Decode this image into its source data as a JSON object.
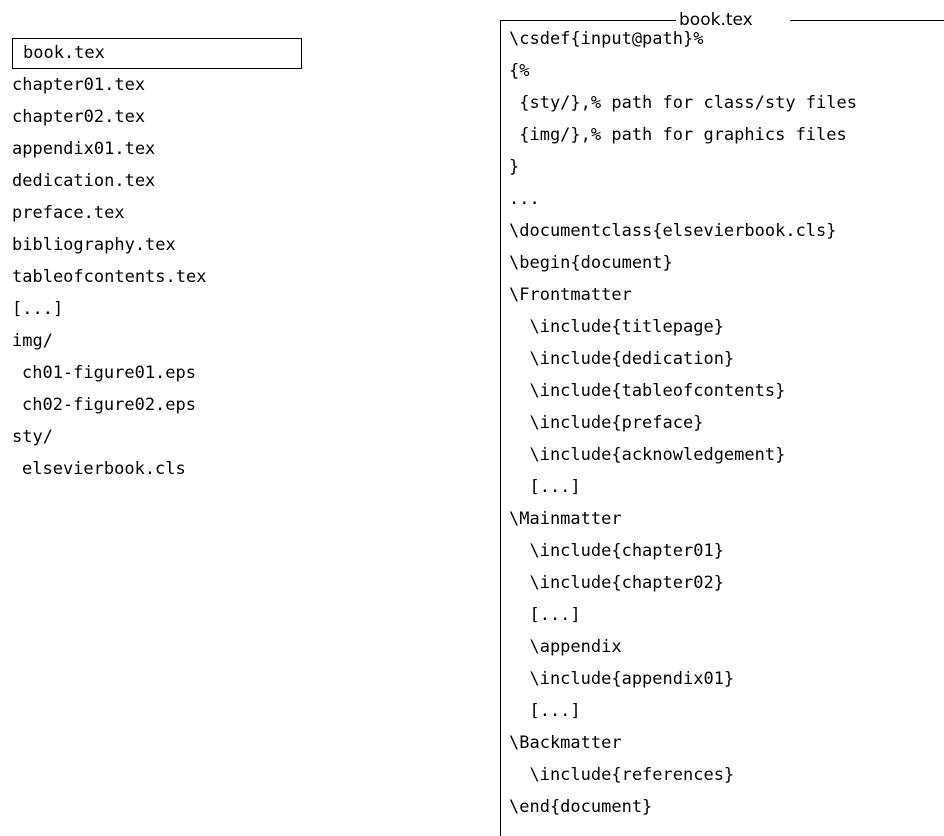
{
  "file_tree": {
    "items": [
      {
        "label": "book.tex",
        "selected": true,
        "indent": false
      },
      {
        "label": "chapter01.tex",
        "selected": false,
        "indent": false
      },
      {
        "label": "chapter02.tex",
        "selected": false,
        "indent": false
      },
      {
        "label": "appendix01.tex",
        "selected": false,
        "indent": false
      },
      {
        "label": "dedication.tex",
        "selected": false,
        "indent": false
      },
      {
        "label": "preface.tex",
        "selected": false,
        "indent": false
      },
      {
        "label": "bibliography.tex",
        "selected": false,
        "indent": false
      },
      {
        "label": "tableofcontents.tex",
        "selected": false,
        "indent": false
      },
      {
        "label": "[...]",
        "selected": false,
        "indent": false
      },
      {
        "label": "img/",
        "selected": false,
        "indent": false
      },
      {
        "label": "ch01-figure01.eps",
        "selected": false,
        "indent": true
      },
      {
        "label": "ch02-figure02.eps",
        "selected": false,
        "indent": true
      },
      {
        "label": "sty/",
        "selected": false,
        "indent": false
      },
      {
        "label": "elsevierbook.cls",
        "selected": false,
        "indent": true
      }
    ]
  },
  "code_panel": {
    "title": "book.tex",
    "lines": [
      "\\csdef{input@path}%",
      "{%",
      " {sty/},% path for class/sty files",
      " {img/},% path for graphics files",
      "}",
      "...",
      "\\documentclass{elsevierbook.cls}",
      "\\begin{document}",
      "\\Frontmatter",
      "  \\include{titlepage}",
      "  \\include{dedication}",
      "  \\include{tableofcontents}",
      "  \\include{preface}",
      "  \\include{acknowledgement}",
      "  [...]",
      "\\Mainmatter",
      "  \\include{chapter01}",
      "  \\include{chapter02}",
      "  [...]",
      "  \\appendix",
      "  \\include{appendix01}",
      "  [...]",
      "\\Backmatter",
      "  \\include{references}",
      "\\end{document}"
    ]
  }
}
